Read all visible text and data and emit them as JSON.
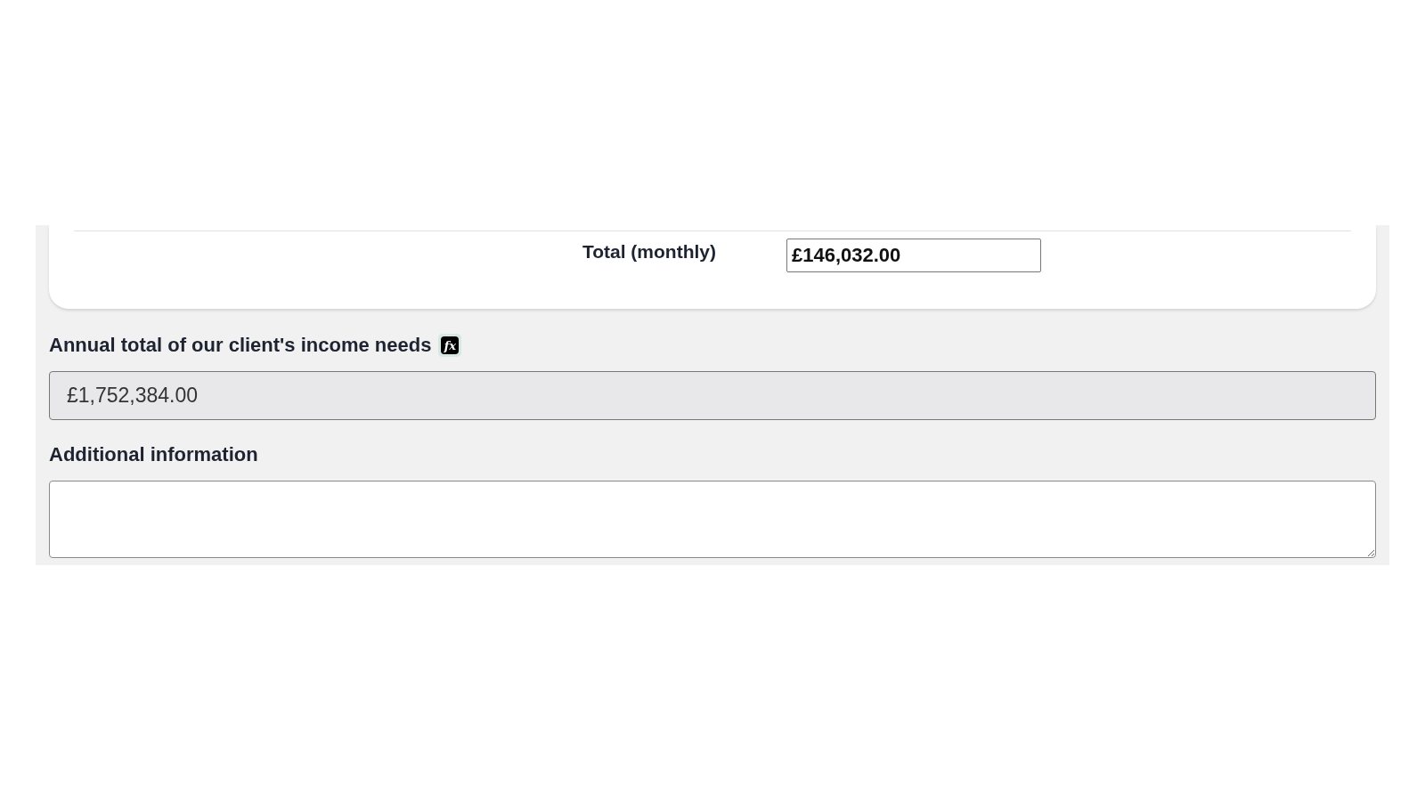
{
  "monthly_total": {
    "label": "Total (monthly)",
    "value": "£146,032.00"
  },
  "annual_total": {
    "label": "Annual total of our client's income needs",
    "formula_icon": "fx",
    "value": "£1,752,384.00",
    "readonly": true
  },
  "additional_information": {
    "label": "Additional information"
  }
}
